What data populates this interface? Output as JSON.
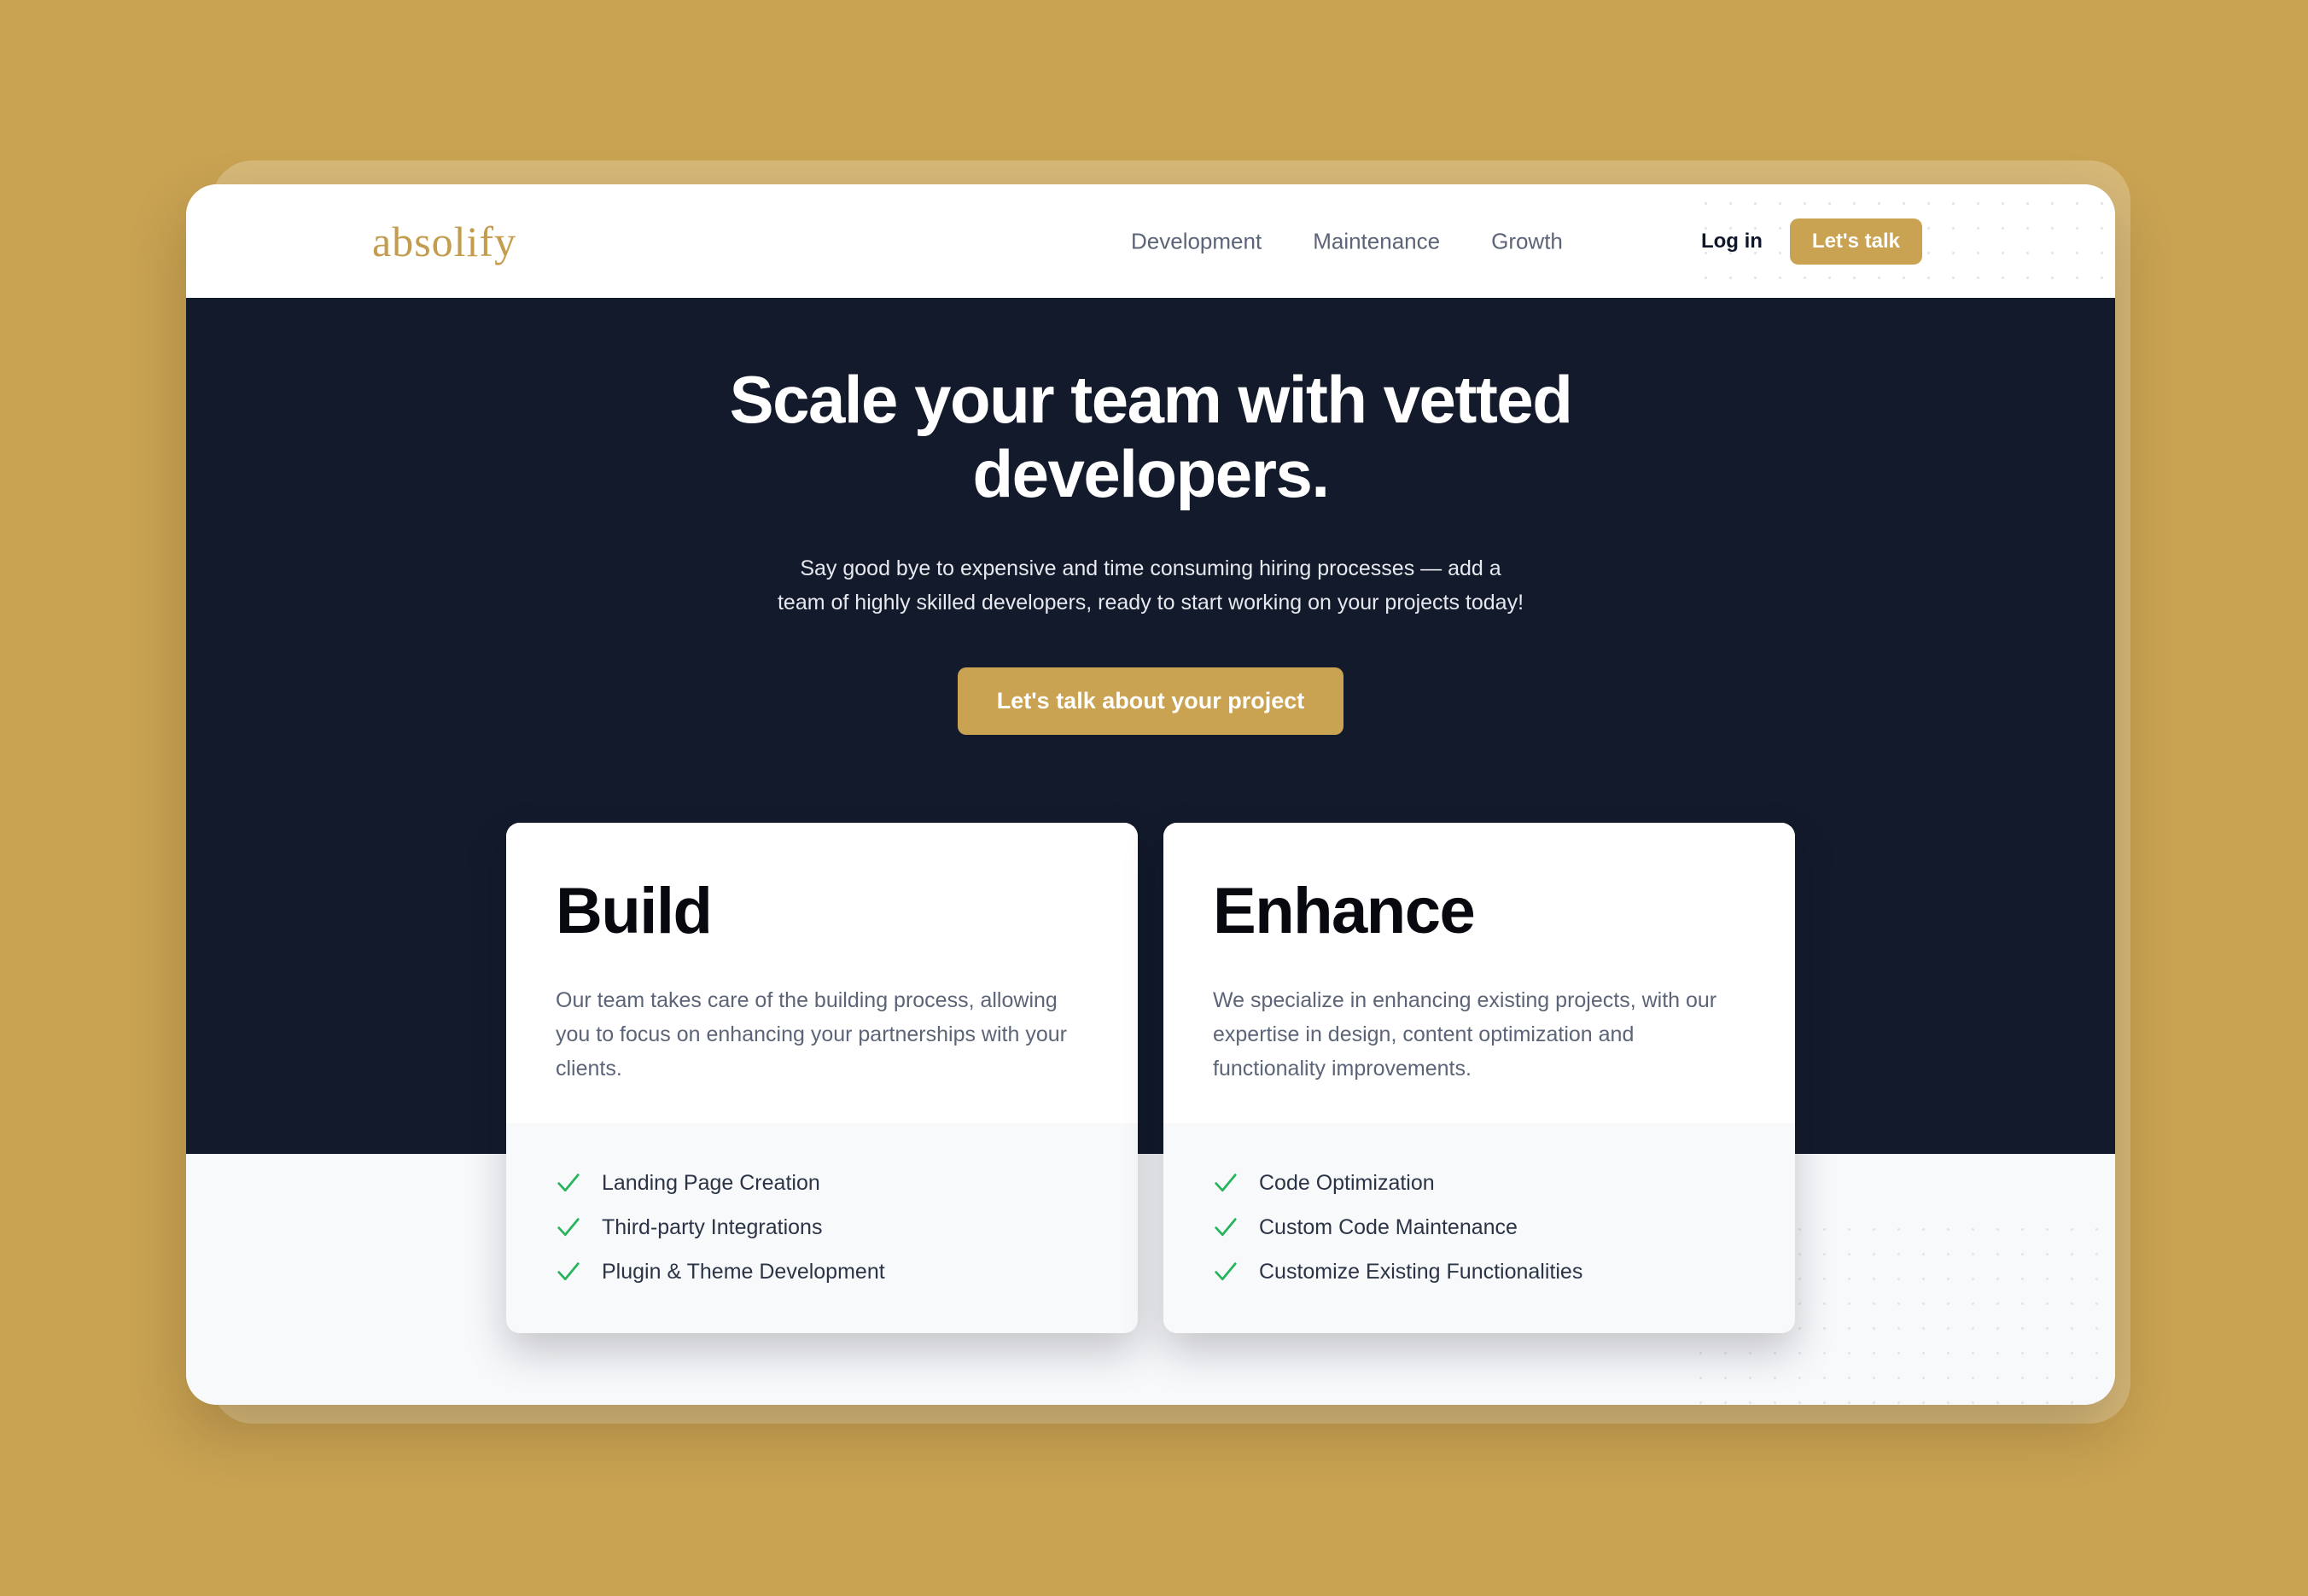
{
  "theme": {
    "gold": "#c9a252",
    "gold_light": "#d6b878",
    "dark_navy": "#131a2c",
    "offwhite": "#f8f9fb",
    "check_green": "#25b35c",
    "nav_gray": "#5c6478"
  },
  "header": {
    "logo": "absolify",
    "nav": [
      {
        "label": "Development"
      },
      {
        "label": "Maintenance"
      },
      {
        "label": "Growth"
      }
    ],
    "login_label": "Log in",
    "cta_label": "Let's talk"
  },
  "hero": {
    "title": "Scale your team with vetted developers.",
    "subtitle": "Say good bye to expensive and time consuming hiring processes — add a team of highly skilled developers, ready to start working on your projects today!",
    "cta_label": "Let's talk about your project"
  },
  "cards": [
    {
      "title": "Build",
      "description": "Our team takes care of the building process, allowing you to focus on enhancing your partnerships with your clients.",
      "features": [
        "Landing Page Creation",
        "Third-party Integrations",
        "Plugin & Theme Development"
      ]
    },
    {
      "title": "Enhance",
      "description": "We specialize in enhancing existing projects, with our expertise in design, content optimization and functionality improvements.",
      "features": [
        "Code Optimization",
        "Custom Code Maintenance",
        "Customize Existing Functionalities"
      ]
    }
  ]
}
